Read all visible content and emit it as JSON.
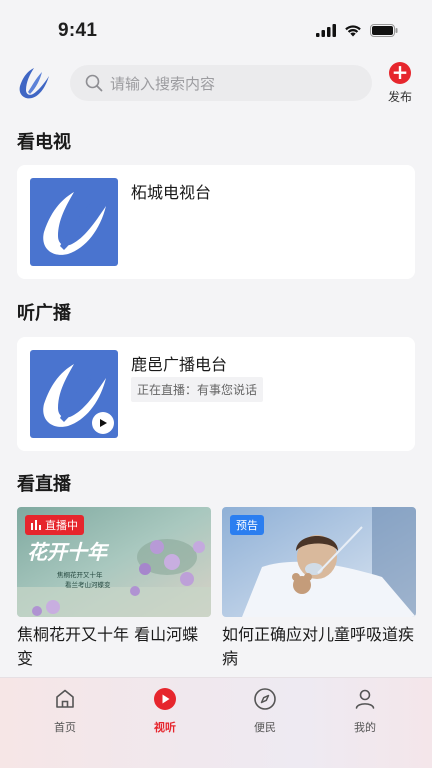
{
  "status_bar": {
    "time": "9:41"
  },
  "header": {
    "search_placeholder": "请输入搜索内容",
    "publish_label": "发布"
  },
  "sections": {
    "tv": {
      "title": "看电视",
      "items": [
        {
          "name": "柘城电视台"
        }
      ]
    },
    "radio": {
      "title": "听广播",
      "items": [
        {
          "name": "鹿邑广播电台",
          "status": "正在直播：有事您说话"
        }
      ]
    },
    "live": {
      "title": "看直播",
      "items": [
        {
          "badge": "直播中",
          "title": "焦桐花开又十年  看山河蝶变",
          "thumb_text": "花开十年",
          "thumb_sub": "焦桐花开又十年\n看兰考山河蝶变"
        },
        {
          "badge": "预告",
          "title": "如何正确应对儿童呼吸道疾病"
        }
      ]
    }
  },
  "tabbar": {
    "tabs": [
      {
        "label": "首页",
        "icon": "home-icon"
      },
      {
        "label": "视听",
        "icon": "play-icon",
        "active": true
      },
      {
        "label": "便民",
        "icon": "compass-icon"
      },
      {
        "label": "我的",
        "icon": "user-icon"
      }
    ]
  },
  "colors": {
    "accent": "#e6262d",
    "logo_blue": "#4a70c8",
    "preview_blue": "#2b7ef0"
  }
}
